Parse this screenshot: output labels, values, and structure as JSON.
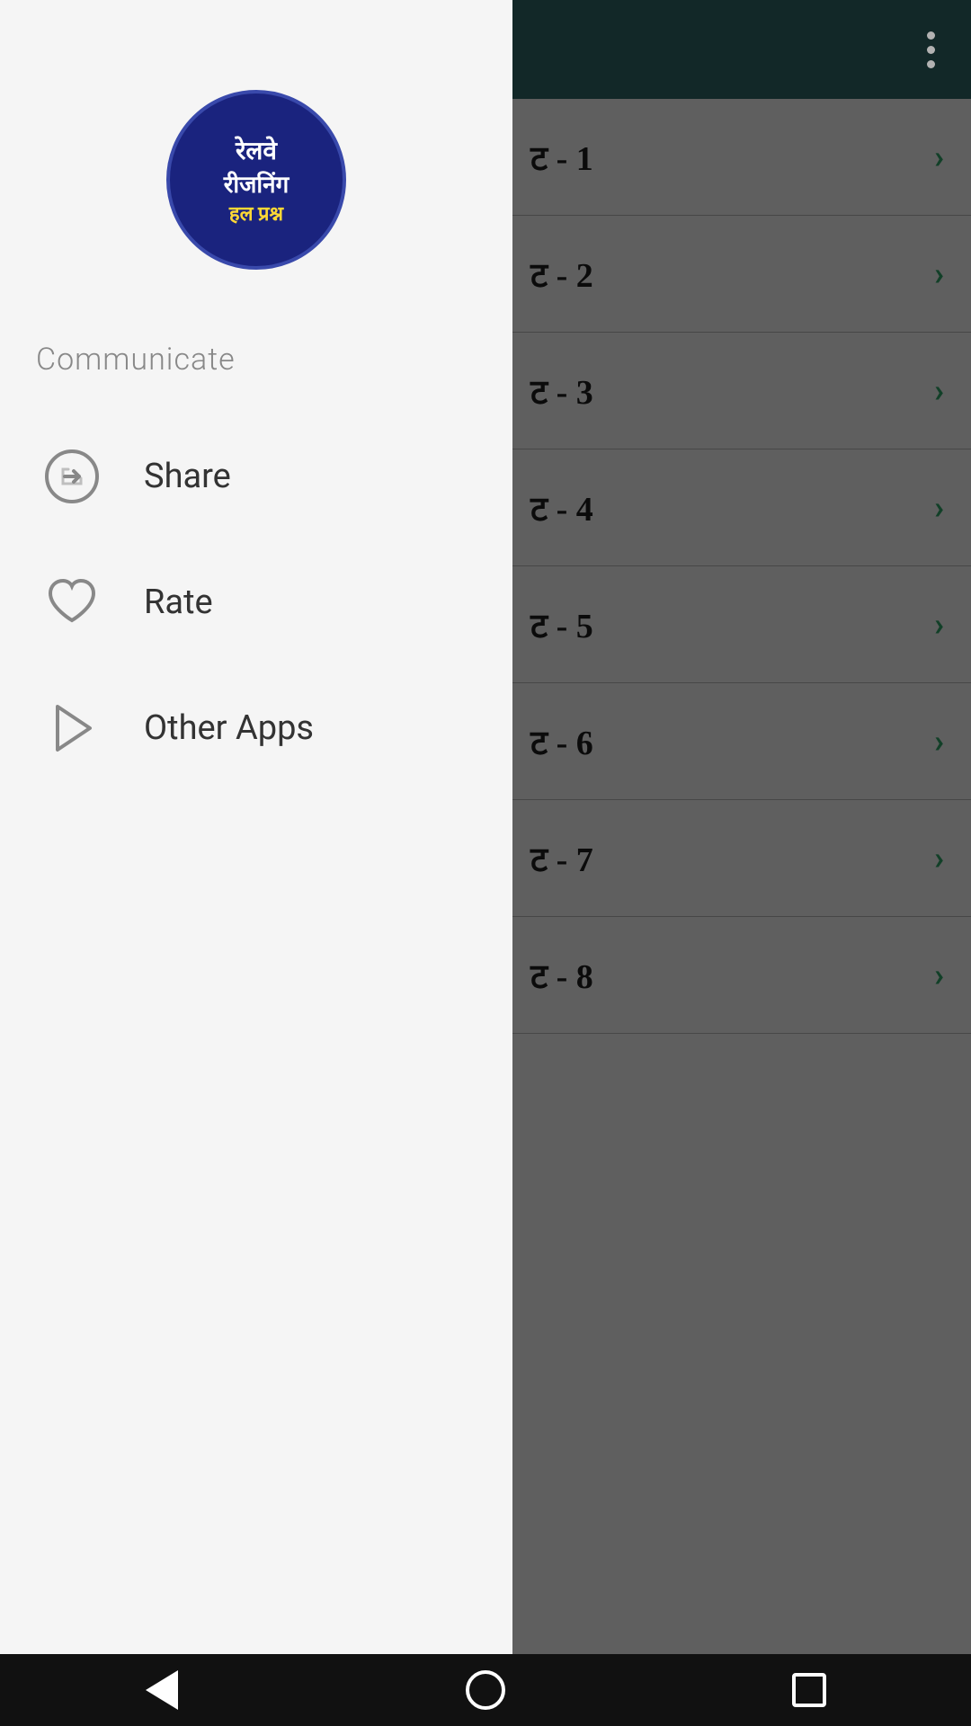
{
  "app": {
    "title": "Railway Reasoning"
  },
  "header": {
    "more_icon_label": "more options"
  },
  "logo": {
    "line1": "रेलवे",
    "line2": "रीजनिंग",
    "line3": "हल प्रश्न",
    "line4": ""
  },
  "drawer": {
    "section_label": "Communicate",
    "menu_items": [
      {
        "id": "share",
        "label": "Share",
        "icon": "share-icon"
      },
      {
        "id": "rate",
        "label": "Rate",
        "icon": "heart-icon"
      },
      {
        "id": "other-apps",
        "label": "Other Apps",
        "icon": "play-icon"
      }
    ]
  },
  "list": {
    "items": [
      {
        "id": 1,
        "text": "ट - 1"
      },
      {
        "id": 2,
        "text": "ट - 2"
      },
      {
        "id": 3,
        "text": "ट - 3"
      },
      {
        "id": 4,
        "text": "ट - 4"
      },
      {
        "id": 5,
        "text": "ट - 5"
      },
      {
        "id": 6,
        "text": "ट - 6"
      },
      {
        "id": 7,
        "text": "ट - 7"
      },
      {
        "id": 8,
        "text": "ट - 8"
      }
    ]
  },
  "bottom_nav": {
    "back_label": "back",
    "home_label": "home",
    "recents_label": "recents"
  }
}
